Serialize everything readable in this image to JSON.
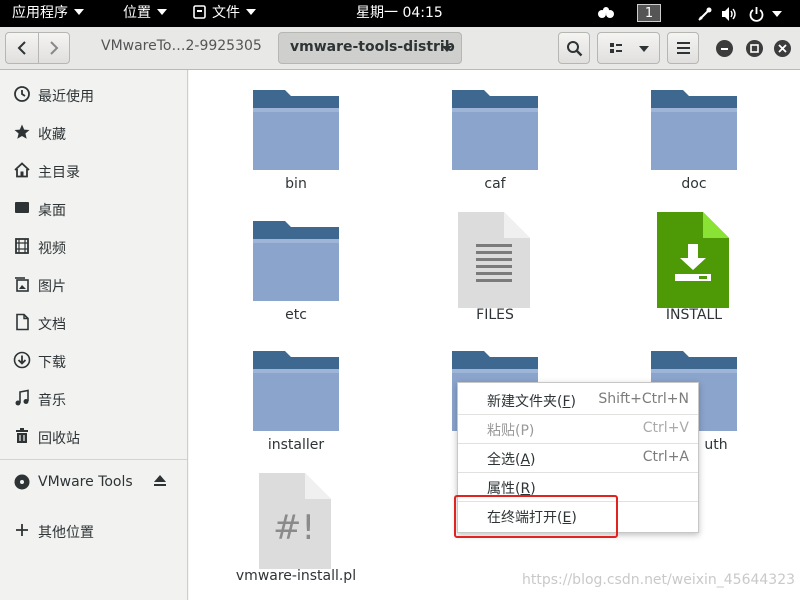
{
  "topbar": {
    "applications": "应用程序",
    "places": "位置",
    "files_menu": "文件",
    "clock": "星期一 04:15",
    "workspace": "1"
  },
  "header": {
    "breadcrumb_parent": "VMwareTo…2-9925305",
    "breadcrumb_current": "vmware-tools-distrib"
  },
  "sidebar": {
    "items": [
      {
        "label": "最近使用",
        "icon": "clock-icon"
      },
      {
        "label": "收藏",
        "icon": "star-icon"
      },
      {
        "label": "主目录",
        "icon": "home-icon"
      },
      {
        "label": "桌面",
        "icon": "desktop-icon"
      },
      {
        "label": "视频",
        "icon": "video-icon"
      },
      {
        "label": "图片",
        "icon": "picture-icon"
      },
      {
        "label": "文档",
        "icon": "document-icon"
      },
      {
        "label": "下载",
        "icon": "download-icon"
      },
      {
        "label": "音乐",
        "icon": "music-icon"
      },
      {
        "label": "回收站",
        "icon": "trash-icon"
      }
    ],
    "device": {
      "label": "VMware Tools",
      "icon": "disc-icon"
    },
    "other": {
      "label": "其他位置",
      "icon": "plus-icon"
    }
  },
  "files": [
    {
      "name": "bin",
      "type": "folder"
    },
    {
      "name": "caf",
      "type": "folder"
    },
    {
      "name": "doc",
      "type": "folder"
    },
    {
      "name": "etc",
      "type": "folder"
    },
    {
      "name": "FILES",
      "type": "text"
    },
    {
      "name": "INSTALL",
      "type": "install"
    },
    {
      "name": "installer",
      "type": "folder"
    },
    {
      "name": "",
      "type": "folder"
    },
    {
      "name": "uth",
      "type": "folder"
    },
    {
      "name": "vmware-install.pl",
      "type": "script"
    }
  ],
  "context_menu": {
    "items": [
      {
        "label_main": "新建文件夹(",
        "mnemonic": "F",
        "label_end": ")",
        "shortcut": "Shift+Ctrl+N",
        "enabled": true
      },
      {
        "label_main": "粘贴(P)",
        "mnemonic": "",
        "label_end": "",
        "shortcut": "Ctrl+V",
        "enabled": false
      },
      {
        "label_main": "全选(",
        "mnemonic": "A",
        "label_end": ")",
        "shortcut": "Ctrl+A",
        "enabled": true
      },
      {
        "label_main": "属性(",
        "mnemonic": "R",
        "label_end": ")",
        "shortcut": "",
        "enabled": true
      },
      {
        "label_main": "在终端打开(",
        "mnemonic": "E",
        "label_end": ")",
        "shortcut": "",
        "enabled": true
      }
    ]
  },
  "watermark": "https://blog.csdn.net/weixin_45644323",
  "colors": {
    "folder": "#8aa4cc",
    "folder_tab": "#3f6891",
    "install": "#4e9a06",
    "highlight": "#e0231e"
  }
}
